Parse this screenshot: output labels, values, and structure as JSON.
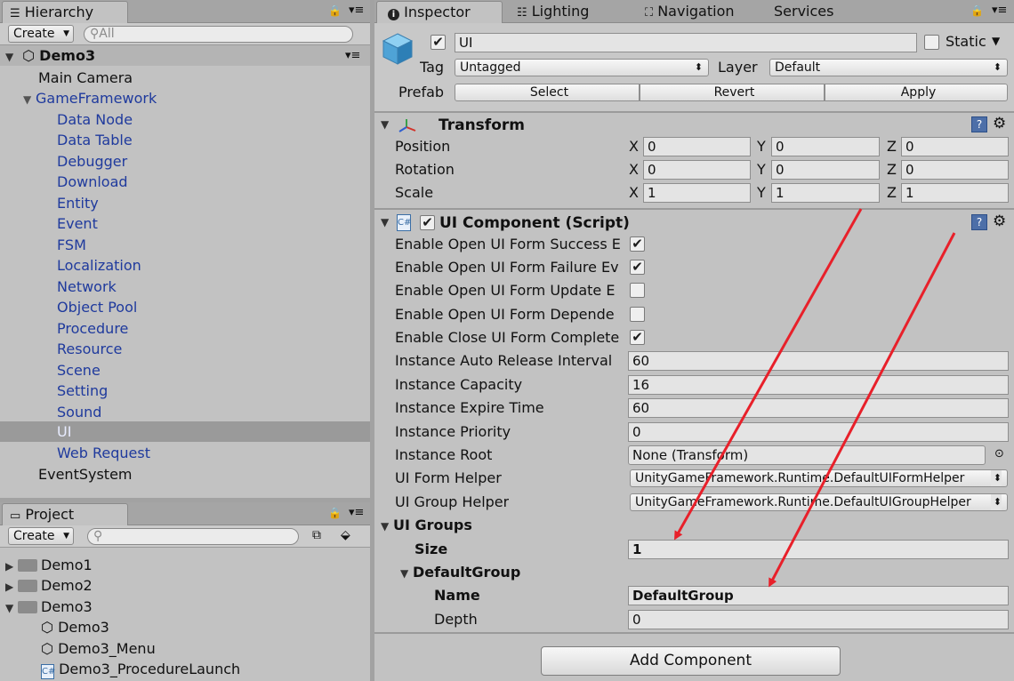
{
  "hierarchy": {
    "tab_label": "Hierarchy",
    "create_label": "Create",
    "search_placeholder": "All",
    "scene_name": "Demo3",
    "items": [
      "Main Camera",
      "GameFramework",
      "Data Node",
      "Data Table",
      "Debugger",
      "Download",
      "Entity",
      "Event",
      "FSM",
      "Localization",
      "Network",
      "Object Pool",
      "Procedure",
      "Resource",
      "Scene",
      "Setting",
      "Sound",
      "UI",
      "Web Request",
      "EventSystem"
    ],
    "selected": "UI"
  },
  "project": {
    "tab_label": "Project",
    "create_label": "Create",
    "folders": [
      "Demo1",
      "Demo2",
      "Demo3"
    ],
    "files": [
      "Demo3",
      "Demo3_Menu",
      "Demo3_ProcedureLaunch"
    ]
  },
  "tabs": {
    "inspector": "Inspector",
    "lighting": "Lighting",
    "navigation": "Navigation",
    "services": "Services"
  },
  "object": {
    "name": "UI",
    "static_label": "Static",
    "tag_label": "Tag",
    "tag_value": "Untagged",
    "layer_label": "Layer",
    "layer_value": "Default",
    "prefab_label": "Prefab",
    "select_label": "Select",
    "revert_label": "Revert",
    "apply_label": "Apply"
  },
  "transform": {
    "title": "Transform",
    "position_label": "Position",
    "rotation_label": "Rotation",
    "scale_label": "Scale",
    "x": "X",
    "y": "Y",
    "z": "Z",
    "position": [
      "0",
      "0",
      "0"
    ],
    "rotation": [
      "0",
      "0",
      "0"
    ],
    "scale": [
      "1",
      "1",
      "1"
    ]
  },
  "ui_component": {
    "title": "UI Component (Script)",
    "toggles": [
      {
        "label": "Enable Open UI Form Success E",
        "checked": true
      },
      {
        "label": "Enable Open UI Form Failure Ev",
        "checked": true
      },
      {
        "label": "Enable Open UI Form Update E",
        "checked": false
      },
      {
        "label": "Enable Open UI Form Depende",
        "checked": false
      },
      {
        "label": "Enable Close UI Form Complete",
        "checked": true
      }
    ],
    "auto_release_label": "Instance Auto Release Interval",
    "auto_release_value": "60",
    "capacity_label": "Instance Capacity",
    "capacity_value": "16",
    "expire_label": "Instance Expire Time",
    "expire_value": "60",
    "priority_label": "Instance Priority",
    "priority_value": "0",
    "root_label": "Instance Root",
    "root_value": "None (Transform)",
    "form_helper_label": "UI Form Helper",
    "form_helper_value": "UnityGameFramework.Runtime.DefaultUIFormHelper",
    "group_helper_label": "UI Group Helper",
    "group_helper_value": "UnityGameFramework.Runtime.DefaultUIGroupHelper",
    "groups_label": "UI Groups",
    "size_label": "Size",
    "size_value": "1",
    "group_name": "DefaultGroup",
    "name_label": "Name",
    "name_value": "DefaultGroup",
    "depth_label": "Depth",
    "depth_value": "0"
  },
  "add_component_label": "Add Component",
  "colors": {
    "annotation_arrow": "#e8202a",
    "hierarchy_blue": "#1f3a9d",
    "selection": "#9a9a9a"
  }
}
